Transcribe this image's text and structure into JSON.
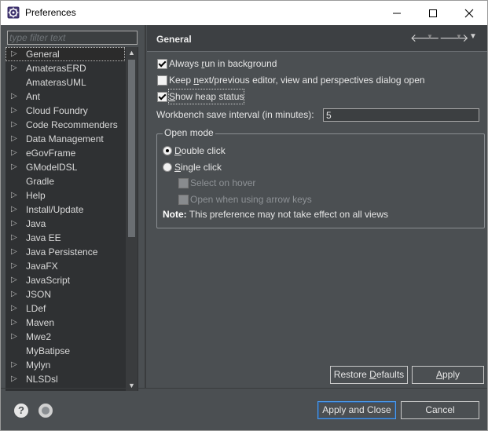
{
  "window": {
    "title": "Preferences",
    "icon": "eclipse-gear-icon"
  },
  "titlebar_buttons": {
    "minimize": "—",
    "maximize": "☐",
    "close": "✕"
  },
  "filter": {
    "placeholder": "type filter text"
  },
  "tree": {
    "items": [
      {
        "label": "General",
        "expandable": true,
        "selected": true
      },
      {
        "label": "AmaterasERD",
        "expandable": true
      },
      {
        "label": "AmaterasUML",
        "expandable": false
      },
      {
        "label": "Ant",
        "expandable": true
      },
      {
        "label": "Cloud Foundry",
        "expandable": true
      },
      {
        "label": "Code Recommenders",
        "expandable": true
      },
      {
        "label": "Data Management",
        "expandable": true
      },
      {
        "label": "eGovFrame",
        "expandable": true
      },
      {
        "label": "GModelDSL",
        "expandable": true
      },
      {
        "label": "Gradle",
        "expandable": false
      },
      {
        "label": "Help",
        "expandable": true
      },
      {
        "label": "Install/Update",
        "expandable": true
      },
      {
        "label": "Java",
        "expandable": true
      },
      {
        "label": "Java EE",
        "expandable": true
      },
      {
        "label": "Java Persistence",
        "expandable": true
      },
      {
        "label": "JavaFX",
        "expandable": true
      },
      {
        "label": "JavaScript",
        "expandable": true
      },
      {
        "label": "JSON",
        "expandable": true
      },
      {
        "label": "LDef",
        "expandable": true
      },
      {
        "label": "Maven",
        "expandable": true
      },
      {
        "label": "Mwe2",
        "expandable": true
      },
      {
        "label": "MyBatipse",
        "expandable": false
      },
      {
        "label": "Mylyn",
        "expandable": true
      },
      {
        "label": "NLSDsl",
        "expandable": true
      }
    ]
  },
  "page": {
    "title": "General",
    "options": {
      "always_run_bg": {
        "pre": "Always ",
        "mn": "r",
        "post": "un in background",
        "checked": true
      },
      "keep_next_prev": {
        "pre": "Keep ",
        "mn": "n",
        "post": "ext/previous editor, view and perspectives dialog open",
        "checked": false
      },
      "show_heap": {
        "pre": "",
        "mn": "S",
        "post": "how heap status",
        "checked": true
      }
    },
    "interval": {
      "label": "Workbench save interval (in minutes):",
      "value": "5"
    },
    "open_mode": {
      "title": "Open mode",
      "double_click": {
        "pre": "",
        "mn": "D",
        "post": "ouble click",
        "selected": true
      },
      "single_click": {
        "pre": "",
        "mn": "S",
        "post": "ingle click",
        "selected": false
      },
      "select_on_hover": "Select on hover",
      "open_arrow_keys": "Open when using arrow keys"
    },
    "note": {
      "bold": "Note:",
      "text": " This preference may not take effect on all views"
    }
  },
  "buttons": {
    "restore_defaults": {
      "pre": "Restore ",
      "mn": "D",
      "post": "efaults"
    },
    "apply": {
      "pre": "",
      "mn": "A",
      "post": "pply"
    },
    "apply_and_close": "Apply and Close",
    "cancel": "Cancel"
  }
}
